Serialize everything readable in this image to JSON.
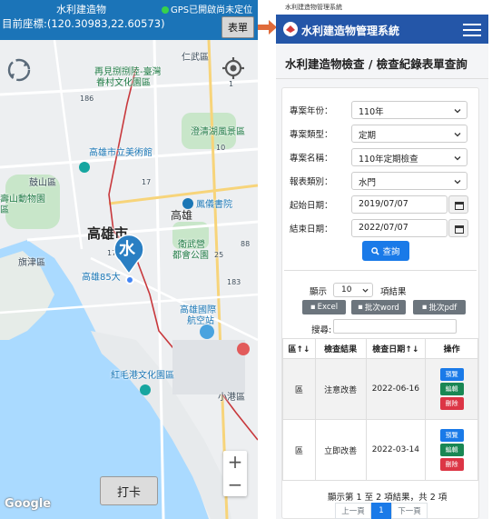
{
  "left_phone": {
    "app_title": "水利建造物",
    "gps_status": "GPS已開啟尚未定位",
    "coordinates": "目前座標:(120.30983,22.60573)",
    "form_button": "表單",
    "map_labels": {
      "renwu": "仁武區",
      "zaixian": "再見捌捌陸-臺灣",
      "zaixian2": "眷村文化園區",
      "chenqing": "澄清湖風景區",
      "gushan": "鼓山區",
      "art_museum": "高雄市立美術館",
      "zoo": "壽山動物園",
      "zoo2": "區",
      "fengyi": "鳳儀書院",
      "kaohsiung_city": "高雄市",
      "kaohsiung": "高雄",
      "weiwu": "衛武營",
      "weiwu2": "都會公園",
      "cijin": "旗津區",
      "kaohsiung85": "高雄85大",
      "airport": "高雄國際",
      "airport2": "航空站",
      "honghao": "紅毛港文化園區",
      "xiaogang": "小港區",
      "road_183": "183",
      "road_17": "17",
      "road_1": "1",
      "road_88": "88",
      "road_10": "10",
      "road_186": "186",
      "road_176": "176",
      "road_25": "25"
    },
    "marker_label": "水",
    "zoom_in": "+",
    "zoom_out": "−",
    "google_logo": "Google",
    "punch_button": "打卡"
  },
  "right_phone": {
    "status_strip": "水利建造物管理系統",
    "nav_title": "水利建造物管理系統",
    "page_title": "水利建造物檢查 / 檢查紀錄表單查詢",
    "form": {
      "year_label": "專案年份：",
      "year_value": "110年",
      "type_label": "專案類型：",
      "type_value": "定期",
      "name_label": "專案名稱：",
      "name_value": "110年定期檢查",
      "report_label": "報表類別：",
      "report_value": "水門",
      "start_label": "起始日期：",
      "start_value": "2019/07/07",
      "end_label": "結束日期：",
      "end_value": "2022/07/07",
      "search_button": "查詢"
    },
    "listing": {
      "show_prefix": "顯示",
      "page_size": "10",
      "show_suffix": "項結果",
      "export_excel": "Excel",
      "export_word": "批次word",
      "export_pdf": "批次pdf",
      "search_label": "搜尋:"
    },
    "table": {
      "headers": [
        "區↑↓",
        "檢查結果",
        "檢查日期↑↓",
        "操作"
      ],
      "rows": [
        {
          "area": "區",
          "result": "注意改善",
          "date": "2022-06-16"
        },
        {
          "area": "區",
          "result": "立即改善",
          "date": "2022-03-14"
        }
      ],
      "action_view": "預覽",
      "action_edit": "編輯",
      "action_delete": "刪除"
    },
    "pagination": {
      "info": "顯示第 1 至 2 項結果，共 2 項",
      "prev": "上一頁",
      "current": "1",
      "next": "下一頁"
    }
  },
  "colors": {
    "left_header": "#1b74b8",
    "right_navbar": "#2456a8",
    "primary": "#1a7ae8",
    "success": "#198754",
    "danger": "#dc3545",
    "secondary": "#6c757d",
    "marker": "#2a7fc3",
    "arrow": "#e06b3a"
  }
}
